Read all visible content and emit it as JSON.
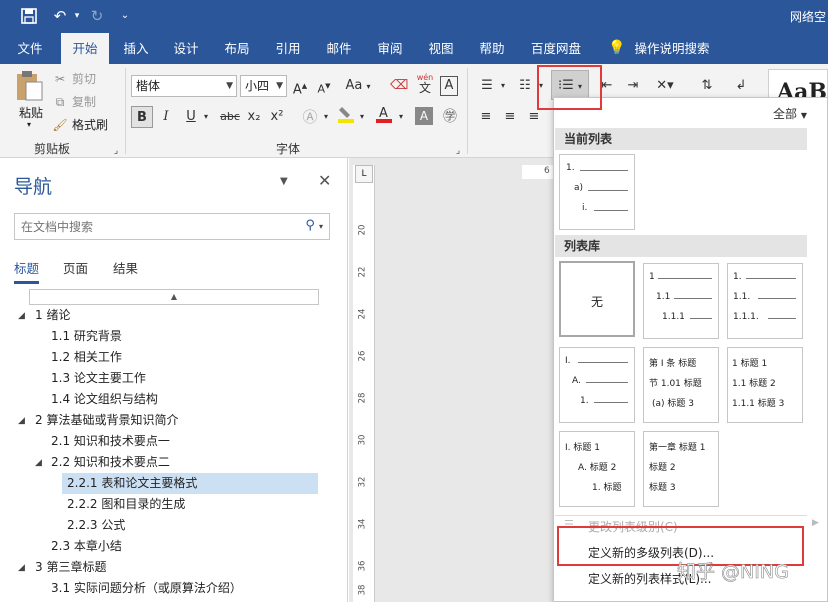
{
  "titlebar": {
    "save_icon": "save-icon",
    "undo_icon": "undo-icon",
    "redo_icon": "redo-icon",
    "customize_icon": "customize-icon",
    "title": "网络空"
  },
  "tabs": [
    {
      "label": "文件"
    },
    {
      "label": "开始"
    },
    {
      "label": "插入"
    },
    {
      "label": "设计"
    },
    {
      "label": "布局"
    },
    {
      "label": "引用"
    },
    {
      "label": "邮件"
    },
    {
      "label": "审阅"
    },
    {
      "label": "视图"
    },
    {
      "label": "帮助"
    },
    {
      "label": "百度网盘"
    },
    {
      "label": "操作说明搜索"
    }
  ],
  "ribbon": {
    "clipboard": {
      "paste": "粘贴",
      "cut": "剪切",
      "copy": "复制",
      "format_painter": "格式刷",
      "label": "剪贴板"
    },
    "font": {
      "font_name": "楷体",
      "font_size": "小四",
      "grow": "A",
      "shrink": "A",
      "case": "Aa",
      "phonetic": "wén",
      "border_char": "A",
      "bold": "B",
      "italic": "I",
      "underline": "U",
      "strike": "abc",
      "subscript": "x₂",
      "superscript": "x²",
      "label": "字体"
    },
    "style_preview": "AaB"
  },
  "nav": {
    "title": "导航",
    "search_placeholder": "在文档中搜索",
    "tabs": [
      {
        "label": "标题"
      },
      {
        "label": "页面"
      },
      {
        "label": "结果"
      }
    ],
    "items": [
      {
        "text": "1 绪论"
      },
      {
        "text": "1.1 研究背景"
      },
      {
        "text": "1.2 相关工作"
      },
      {
        "text": "1.3 论文主要工作"
      },
      {
        "text": "1.4 论文组织与结构"
      },
      {
        "text": "2 算法基础或背景知识简介"
      },
      {
        "text": "2.1 知识和技术要点一"
      },
      {
        "text": "2.2 知识和技术要点二"
      },
      {
        "text": "2.2.1 表和论文主要格式"
      },
      {
        "text": "2.2.2 图和目录的生成"
      },
      {
        "text": "2.2.3 公式"
      },
      {
        "text": "2.3 本章小结"
      },
      {
        "text": "3 第三章标题"
      },
      {
        "text": "3.1 实际问题分析（或原算法介绍）"
      }
    ]
  },
  "ruler": {
    "corner": "L",
    "h_mark": "6",
    "marks": [
      "20",
      "22",
      "24",
      "26",
      "28",
      "30",
      "32",
      "34",
      "36",
      "38"
    ]
  },
  "dropdown": {
    "filter": "全部",
    "current_section": "当前列表",
    "library_section": "列表库",
    "current_thumb": [
      "1.",
      "a)",
      "i."
    ],
    "none_label": "无",
    "thumbs": [
      [
        "1",
        "1.1",
        "1.1.1"
      ],
      [
        "1.",
        "1.1.",
        "1.1.1."
      ],
      [
        "I.",
        "A.",
        "1."
      ],
      [
        "第 I 条 标题",
        "节 1.01 标题",
        "(a) 标题 3"
      ],
      [
        "1 标题 1",
        "1.1 标题 2",
        "1.1.1 标题 3"
      ],
      [
        "I. 标题 1",
        "A. 标题 2",
        "1. 标题"
      ],
      [
        "第一章 标题 1",
        "标题 2",
        "标题 3"
      ]
    ],
    "menu": {
      "change_level": "更改列表级别(C)",
      "define_multilevel": "定义新的多级列表(D)...",
      "define_style": "定义新的列表样式(L)..."
    }
  },
  "watermark": "知乎 @NING"
}
